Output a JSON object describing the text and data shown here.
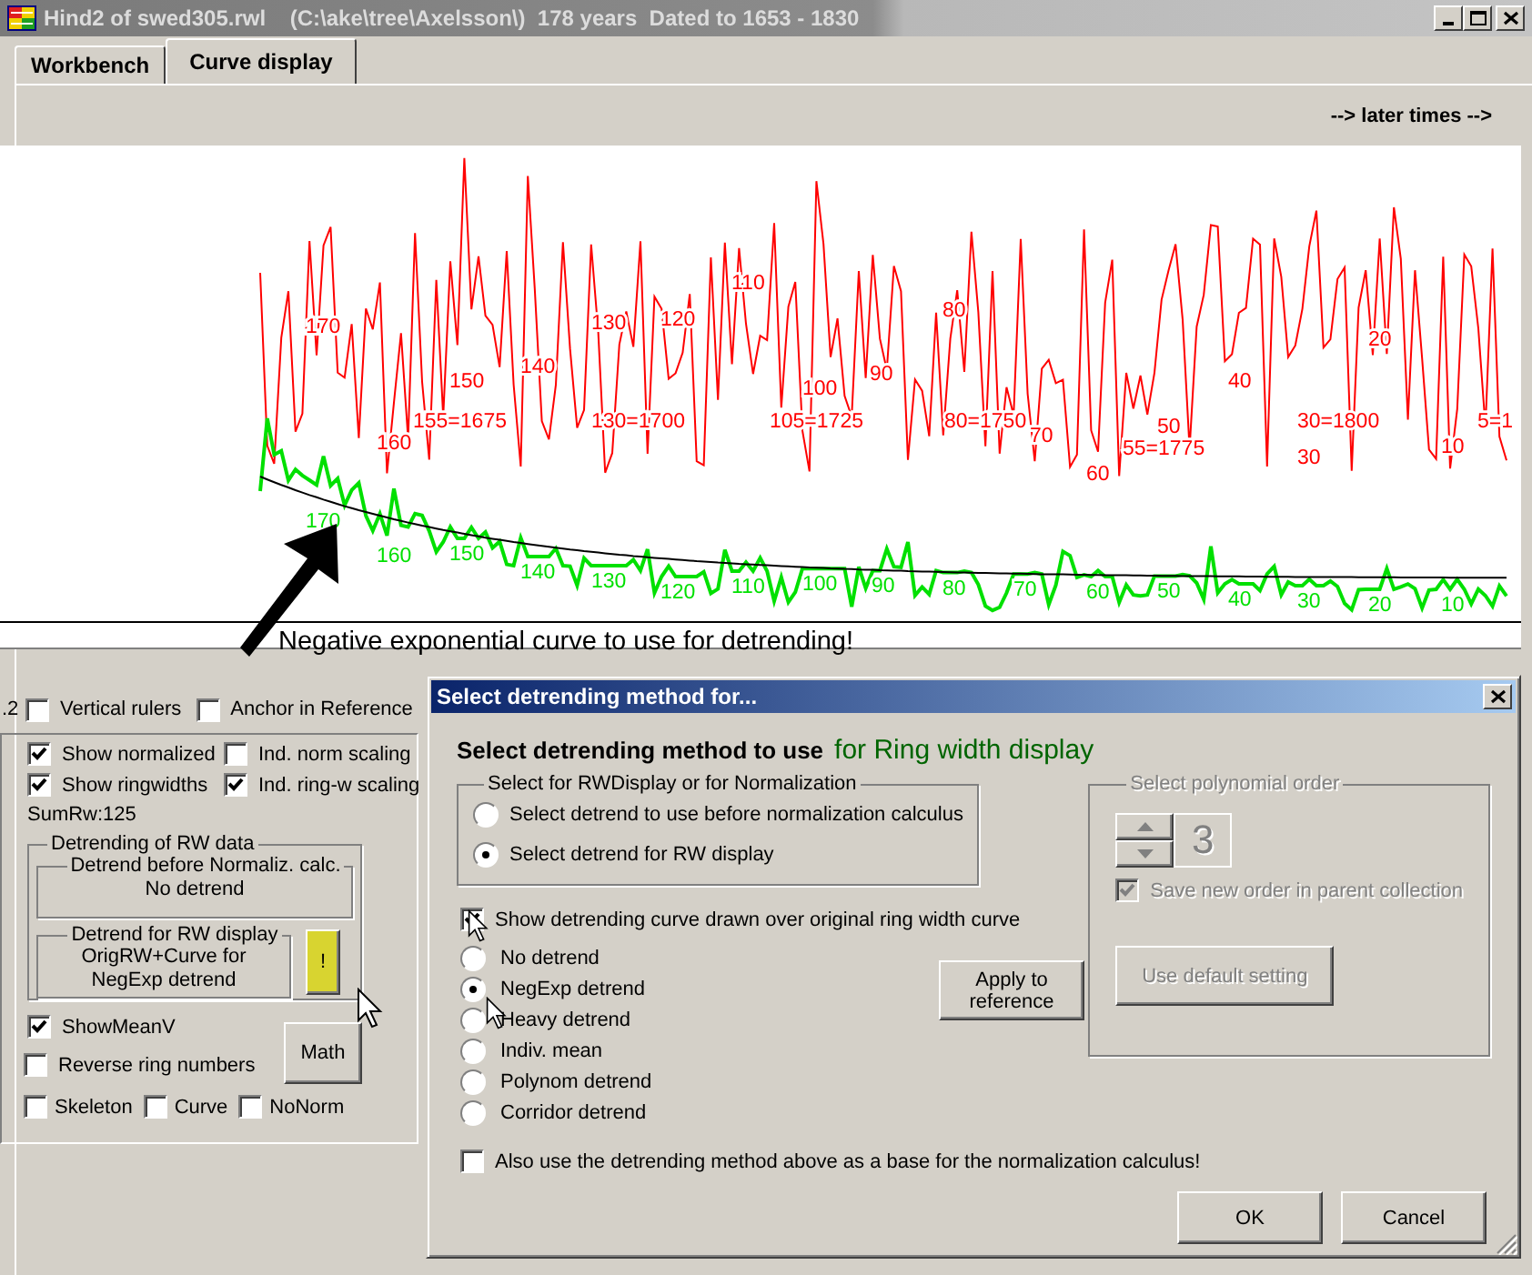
{
  "window": {
    "title": "Hind2 of swed305.rwl    (C:\\ake\\tree\\Axelsson\\)  178 years  Dated to 1653 - 1830"
  },
  "tabs": [
    {
      "label": "Workbench",
      "selected": false
    },
    {
      "label": "Curve display",
      "selected": true
    }
  ],
  "time_direction": "--> later times -->",
  "chart": {
    "ring_width_labels": [
      "170",
      "160",
      "155=1675",
      "150",
      "140",
      "130",
      "130=1700",
      "120",
      "110",
      "100",
      "105=1725",
      "90",
      "80",
      "80=1750",
      "70",
      "60",
      "55=1775",
      "50",
      "40",
      "30=1800",
      "30",
      "20",
      "10",
      "5=1"
    ],
    "normalized_labels": [
      "170",
      "160",
      "150",
      "140",
      "130",
      "120",
      "110",
      "100",
      "90",
      "80",
      "70",
      "60",
      "50",
      "40",
      "30",
      "20",
      "10"
    ],
    "annotation": "Negative exponential curve to use for detrending!"
  },
  "display_options": {
    "cut_text": ".2",
    "top_checks": [
      {
        "label": "Vertical rulers",
        "checked": false
      },
      {
        "label": "Anchor in Reference",
        "checked": false
      }
    ],
    "checks": [
      {
        "label": "Show normalized",
        "checked": true
      },
      {
        "label": "Ind. norm scaling",
        "checked": false
      },
      {
        "label": "Show ringwidths",
        "checked": true
      },
      {
        "label": "Ind. ring-w scaling",
        "checked": true
      }
    ],
    "sum": "SumRw:125",
    "detrending": {
      "title": "Detrending of RW data",
      "before": {
        "title": "Detrend before Normaliz. calc.",
        "value": "No detrend"
      },
      "display": {
        "title": "Detrend for RW display",
        "value": "OrigRW+Curve for NegExp detrend"
      },
      "button": "!"
    },
    "show_mean": {
      "label": "ShowMeanV",
      "checked": true
    },
    "reverse": {
      "label": "Reverse ring numbers",
      "checked": false
    },
    "math_button": "Math",
    "bottom_checks": [
      {
        "label": "Skeleton",
        "checked": false
      },
      {
        "label": "Curve",
        "checked": false
      },
      {
        "label": "NoNorm",
        "checked": false
      }
    ]
  },
  "dialog": {
    "title": "Select detrending method for...",
    "heading": "Select detrending method to use",
    "heading_target": "for Ring width display",
    "target_group": {
      "title": "Select for RWDisplay or for Normalization",
      "options": [
        {
          "label": "Select detrend to use before normalization calculus",
          "selected": false
        },
        {
          "label": "Select detrend for RW display",
          "selected": true
        }
      ]
    },
    "show_curve": {
      "label": "Show detrending curve drawn over original ring width curve",
      "checked": true
    },
    "methods": [
      {
        "label": "No detrend",
        "selected": false
      },
      {
        "label": "NegExp detrend",
        "selected": true
      },
      {
        "label": "Heavy detrend",
        "selected": false
      },
      {
        "label": "Indiv. mean",
        "selected": false
      },
      {
        "label": "Polynom detrend",
        "selected": false
      },
      {
        "label": "Corridor detrend",
        "selected": false
      }
    ],
    "apply_button": "Apply to reference",
    "polynomial": {
      "title": "Select polynomial order",
      "disabled": true,
      "order": "3",
      "save": {
        "label": "Save new order in parent collection",
        "checked": true
      },
      "default_button": "Use default setting"
    },
    "also_use": {
      "label": "Also use the detrending method above as a base for the normalization calculus!",
      "checked": false
    },
    "buttons": [
      "OK",
      "Cancel"
    ]
  }
}
